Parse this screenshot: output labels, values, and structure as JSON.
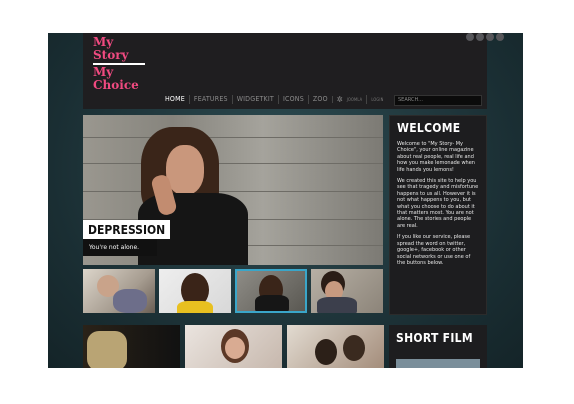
{
  "logo": {
    "line1": "My",
    "line2": "Story",
    "line3": "My",
    "line4": "Choice"
  },
  "nav": {
    "items": [
      "HOME",
      "FEATURES",
      "WIDGETKIT",
      "ICONS",
      "ZOO"
    ],
    "joomla_label": "JOOMLA",
    "login_label": "LOGIN"
  },
  "search": {
    "placeholder": "SEARCH..."
  },
  "hero": {
    "title": "DEPRESSION",
    "subtitle": "You're not alone."
  },
  "welcome": {
    "title": "WELCOME",
    "p1": "Welcome to \"My Story- My Choice\", your online magazine about real people, real life and how you make lemonade when life hands you lemons!",
    "p2": "We created this site to help you see that tragedy and misfortune happens to us all. However it is not what happens to you, but what you choose to do about it that matters most. You are not alone. The stories and people are real.",
    "p3": "If you like our service, please spread the word on twitter, google+, facebook or other social networks or use one of the buttons below."
  },
  "film": {
    "title": "SHORT FILM"
  },
  "colors": {
    "accent": "#f04a80",
    "active_thumb": "#3aa6c9",
    "background": "#1d3338"
  }
}
